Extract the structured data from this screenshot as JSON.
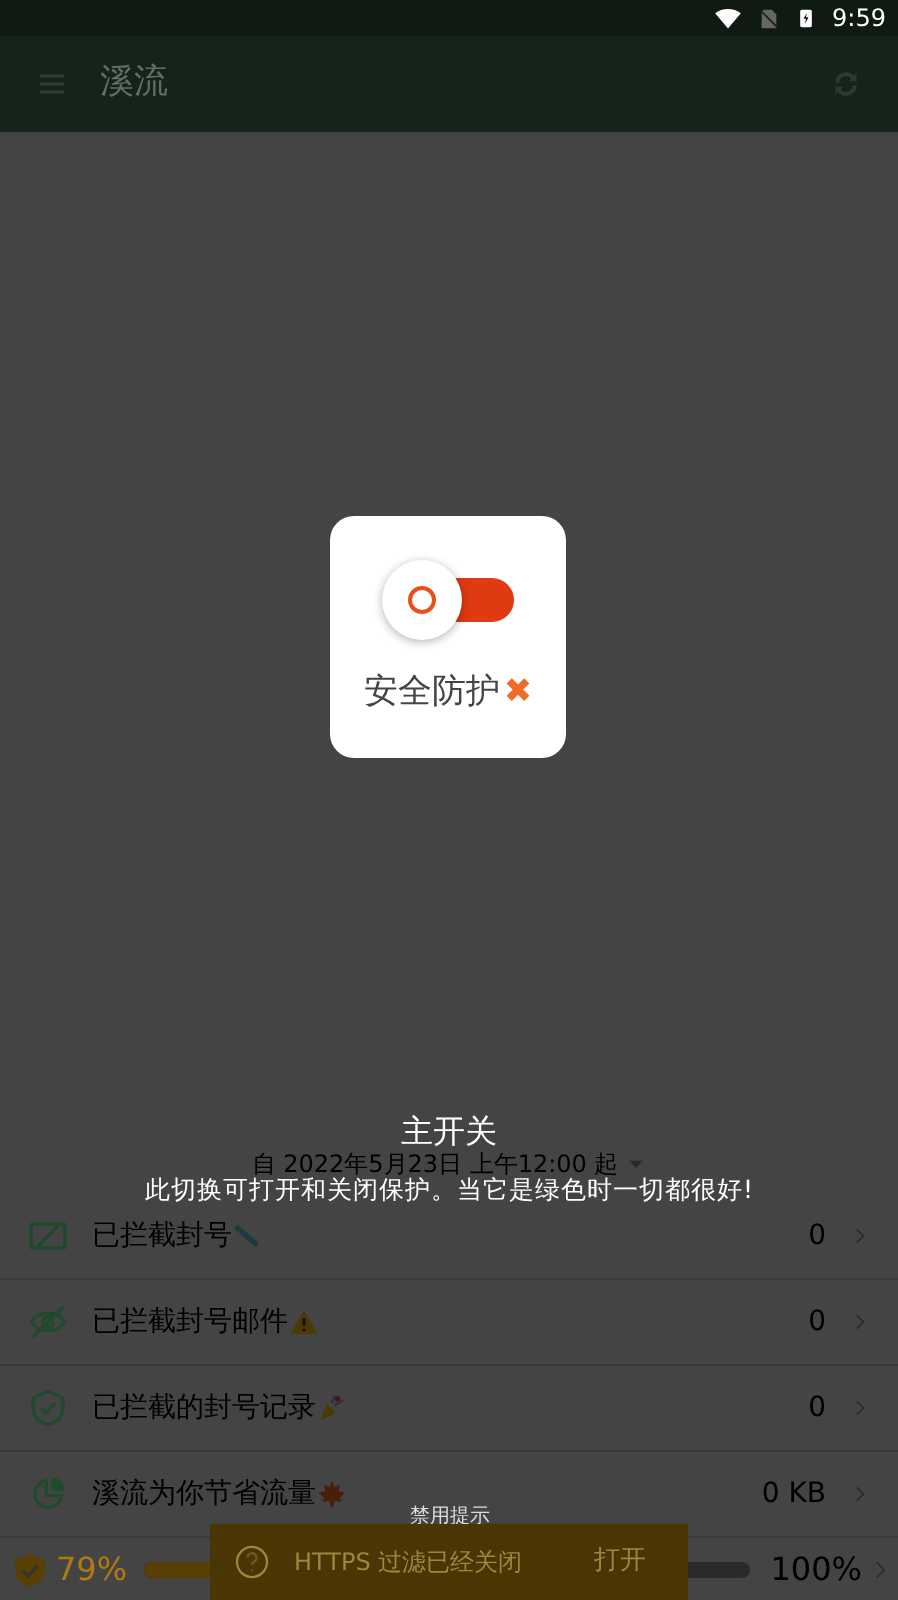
{
  "status_bar": {
    "time": "9:59"
  },
  "app_bar": {
    "title": "溪流"
  },
  "protection_card": {
    "label": "安全防护",
    "on": false,
    "mark": "✖"
  },
  "tutorial": {
    "title": "主开关",
    "description": "此切换可打开和关闭保护。当它是绿色时一切都很好!"
  },
  "stats": {
    "since": "自 2022年5月23日 上午12:00 起",
    "rows": [
      {
        "label": "已拦截封号",
        "value": "0"
      },
      {
        "label": "已拦截封号邮件",
        "value": "0"
      },
      {
        "label": "已拦截的封号记录",
        "value": "0"
      },
      {
        "label": "溪流为你节省流量",
        "value": "0 KB"
      }
    ]
  },
  "bottom_bar": {
    "percent": "79%",
    "level": 0.79,
    "max": "100%"
  },
  "snackbar": {
    "caption": "禁用提示",
    "message": "HTTPS 过滤已经关闭",
    "action": "打开"
  }
}
